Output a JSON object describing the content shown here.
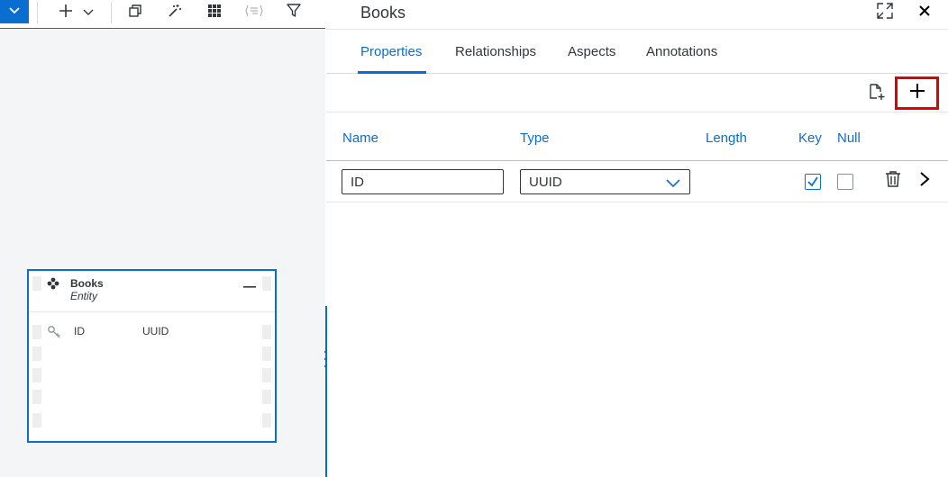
{
  "toolbar": {
    "icons": [
      "chevron-down-icon",
      "plus-icon",
      "chevron-down-icon",
      "copy-icon",
      "magic-wand-icon",
      "grid-icon",
      "layout-icon",
      "filter-icon"
    ]
  },
  "entity": {
    "name": "Books",
    "kind": "Entity",
    "properties": [
      {
        "name": "ID",
        "type": "UUID"
      }
    ]
  },
  "panel": {
    "title": "Books",
    "tabs": [
      "Properties",
      "Relationships",
      "Aspects",
      "Annotations"
    ],
    "active_tab": "Properties",
    "columns": {
      "name": "Name",
      "type": "Type",
      "length": "Length",
      "key": "Key",
      "null": "Null"
    },
    "rows": [
      {
        "name": "ID",
        "type": "UUID",
        "key": true,
        "null": false
      }
    ]
  },
  "colors": {
    "accent": "#0a6ed1",
    "highlight": "#e00000",
    "text": "#32363a"
  }
}
